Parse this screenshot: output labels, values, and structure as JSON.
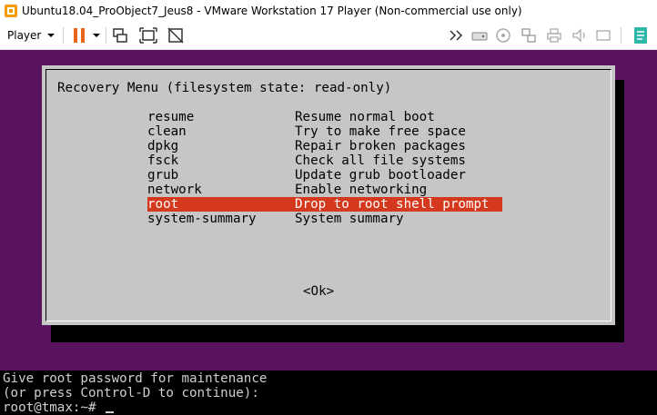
{
  "window": {
    "title": "Ubuntu18.04_ProObject7_Jeus8 - VMware Workstation 17 Player (Non-commercial use only)"
  },
  "toolbar": {
    "player_label": "Player",
    "icons": [
      "pause-icon",
      "send-ctrl-alt-del-icon",
      "fit-guest-icon",
      "unity-mode-icon",
      "forward-icon",
      "hard-disk-icon",
      "cd-dvd-icon",
      "network-adapter-icon",
      "printer-icon",
      "sound-icon",
      "library-icon"
    ],
    "accent_color": "#e8641b"
  },
  "recovery": {
    "title": "Recovery Menu (filesystem state: read-only)",
    "items": [
      {
        "cmd": "resume",
        "desc": "Resume normal boot"
      },
      {
        "cmd": "clean",
        "desc": "Try to make free space"
      },
      {
        "cmd": "dpkg",
        "desc": "Repair broken packages"
      },
      {
        "cmd": "fsck",
        "desc": "Check all file systems"
      },
      {
        "cmd": "grub",
        "desc": "Update grub bootloader"
      },
      {
        "cmd": "network",
        "desc": "Enable networking"
      },
      {
        "cmd": "root",
        "desc": "Drop to root shell prompt"
      },
      {
        "cmd": "system-summary",
        "desc": "System summary"
      }
    ],
    "selected": "root",
    "ok_label": "<Ok>",
    "highlight_color": "#d5391d",
    "background_color": "#5a145f"
  },
  "console": {
    "line1": "Give root password for maintenance",
    "line2": "(or press Control-D to continue):",
    "prompt": "root@tmax:~# "
  }
}
